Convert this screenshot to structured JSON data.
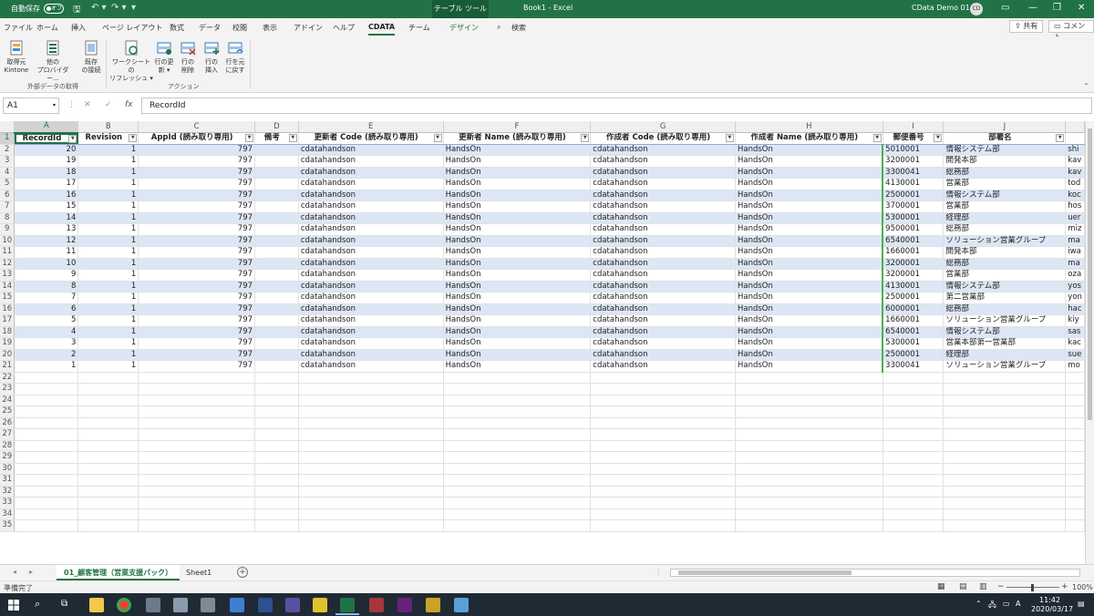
{
  "titlebar": {
    "autosave": "自動保存",
    "toggle": "オフ",
    "context_tab": "テーブル ツール",
    "doc_title": "Book1  -  Excel",
    "user_name": "CData Demo 01",
    "user_initials": "CD"
  },
  "menu": {
    "tabs": [
      "ファイル",
      "ホーム",
      "挿入",
      "ページ レイアウト",
      "数式",
      "データ",
      "校閲",
      "表示",
      "アドイン",
      "ヘルプ",
      "CDATA",
      "チーム",
      "デザイン"
    ],
    "active_tab": "CDATA",
    "search": "検索",
    "share": "共有",
    "comment": "コメント"
  },
  "ribbon": {
    "buttons": [
      {
        "line1": "取得元",
        "line2": "Kintone"
      },
      {
        "line1": "他の",
        "line2": "プロバイダー..."
      },
      {
        "line1": "既存",
        "line2": "の接続"
      },
      {
        "line1": "ワークシートの",
        "line2": "リフレッシュ ▾"
      },
      {
        "line1": "行の更",
        "line2": "新 ▾"
      },
      {
        "line1": "行の",
        "line2": "削除"
      },
      {
        "line1": "行の",
        "line2": "挿入"
      },
      {
        "line1": "行を元",
        "line2": "に戻す"
      }
    ],
    "group_external": "外部データの取得",
    "group_action": "アクション"
  },
  "formula_bar": {
    "name_box": "A1",
    "fx": "fx",
    "value": "RecordId"
  },
  "sheet": {
    "column_letters": [
      "A",
      "B",
      "C",
      "D",
      "E",
      "F",
      "G",
      "H",
      "I",
      "J",
      ""
    ],
    "headers": [
      "RecordId",
      "Revision",
      "AppId (読み取り専用)",
      "備考",
      "更新者 Code (読み取り専用)",
      "更新者 Name (読み取り専用)",
      "作成者 Code (読み取り専用)",
      "作成者 Name (読み取り専用)",
      "郵便番号",
      "部署名",
      ""
    ],
    "rows": [
      [
        "20",
        "1",
        "797",
        "",
        "cdatahandson",
        "HandsOn",
        "cdatahandson",
        "HandsOn",
        "5010001",
        "情報システム部",
        "shi"
      ],
      [
        "19",
        "1",
        "797",
        "",
        "cdatahandson",
        "HandsOn",
        "cdatahandson",
        "HandsOn",
        "3200001",
        "開発本部",
        "kav"
      ],
      [
        "18",
        "1",
        "797",
        "",
        "cdatahandson",
        "HandsOn",
        "cdatahandson",
        "HandsOn",
        "3300041",
        "総務部",
        "kav"
      ],
      [
        "17",
        "1",
        "797",
        "",
        "cdatahandson",
        "HandsOn",
        "cdatahandson",
        "HandsOn",
        "4130001",
        "営業部",
        "tod"
      ],
      [
        "16",
        "1",
        "797",
        "",
        "cdatahandson",
        "HandsOn",
        "cdatahandson",
        "HandsOn",
        "2500001",
        "情報システム部",
        "koc"
      ],
      [
        "15",
        "1",
        "797",
        "",
        "cdatahandson",
        "HandsOn",
        "cdatahandson",
        "HandsOn",
        "3700001",
        "営業部",
        "hos"
      ],
      [
        "14",
        "1",
        "797",
        "",
        "cdatahandson",
        "HandsOn",
        "cdatahandson",
        "HandsOn",
        "5300001",
        "経理部",
        "uer"
      ],
      [
        "13",
        "1",
        "797",
        "",
        "cdatahandson",
        "HandsOn",
        "cdatahandson",
        "HandsOn",
        "9500001",
        "総務部",
        "miz"
      ],
      [
        "12",
        "1",
        "797",
        "",
        "cdatahandson",
        "HandsOn",
        "cdatahandson",
        "HandsOn",
        "6540001",
        "ソリューション営業グループ",
        "ma"
      ],
      [
        "11",
        "1",
        "797",
        "",
        "cdatahandson",
        "HandsOn",
        "cdatahandson",
        "HandsOn",
        "1660001",
        "開発本部",
        "iwa"
      ],
      [
        "10",
        "1",
        "797",
        "",
        "cdatahandson",
        "HandsOn",
        "cdatahandson",
        "HandsOn",
        "3200001",
        "総務部",
        "ma"
      ],
      [
        "9",
        "1",
        "797",
        "",
        "cdatahandson",
        "HandsOn",
        "cdatahandson",
        "HandsOn",
        "3200001",
        "営業部",
        "oza"
      ],
      [
        "8",
        "1",
        "797",
        "",
        "cdatahandson",
        "HandsOn",
        "cdatahandson",
        "HandsOn",
        "4130001",
        "情報システム部",
        "yos"
      ],
      [
        "7",
        "1",
        "797",
        "",
        "cdatahandson",
        "HandsOn",
        "cdatahandson",
        "HandsOn",
        "2500001",
        "第二営業部",
        "yon"
      ],
      [
        "6",
        "1",
        "797",
        "",
        "cdatahandson",
        "HandsOn",
        "cdatahandson",
        "HandsOn",
        "6000001",
        "総務部",
        "hac"
      ],
      [
        "5",
        "1",
        "797",
        "",
        "cdatahandson",
        "HandsOn",
        "cdatahandson",
        "HandsOn",
        "1660001",
        "ソリューション営業グループ",
        "kiy"
      ],
      [
        "4",
        "1",
        "797",
        "",
        "cdatahandson",
        "HandsOn",
        "cdatahandson",
        "HandsOn",
        "6540001",
        "情報システム部",
        "sas"
      ],
      [
        "3",
        "1",
        "797",
        "",
        "cdatahandson",
        "HandsOn",
        "cdatahandson",
        "HandsOn",
        "5300001",
        "営業本部第一営業部",
        "kac"
      ],
      [
        "2",
        "1",
        "797",
        "",
        "cdatahandson",
        "HandsOn",
        "cdatahandson",
        "HandsOn",
        "2500001",
        "経理部",
        "sue"
      ],
      [
        "1",
        "1",
        "797",
        "",
        "cdatahandson",
        "HandsOn",
        "cdatahandson",
        "HandsOn",
        "3300041",
        "ソリューション営業グループ",
        "mo"
      ]
    ],
    "empty_row_numbers": [
      "22",
      "23",
      "24",
      "25",
      "26",
      "27",
      "28",
      "29",
      "30",
      "31",
      "32",
      "33",
      "34",
      "35"
    ]
  },
  "sheet_tabs": {
    "active": "01_顧客管理（営業支援パック）",
    "other": "Sheet1"
  },
  "status": {
    "ready": "準備完了",
    "zoom": "100%"
  },
  "taskbar": {
    "time": "11:42",
    "date": "2020/03/17",
    "ime": "A"
  },
  "colors": {
    "excel_green": "#217346",
    "band_blue": "#dce6f5",
    "taskbar": "#1f2a35"
  },
  "icons": [
    "autosave-toggle",
    "save-icon",
    "undo-icon",
    "redo-icon",
    "search-icon",
    "windows-start-icon",
    "taskbar-search-icon",
    "task-view-icon",
    "file-explorer-icon",
    "chrome-icon",
    "excel-icon",
    "access-icon",
    "visual-studio-icon"
  ]
}
